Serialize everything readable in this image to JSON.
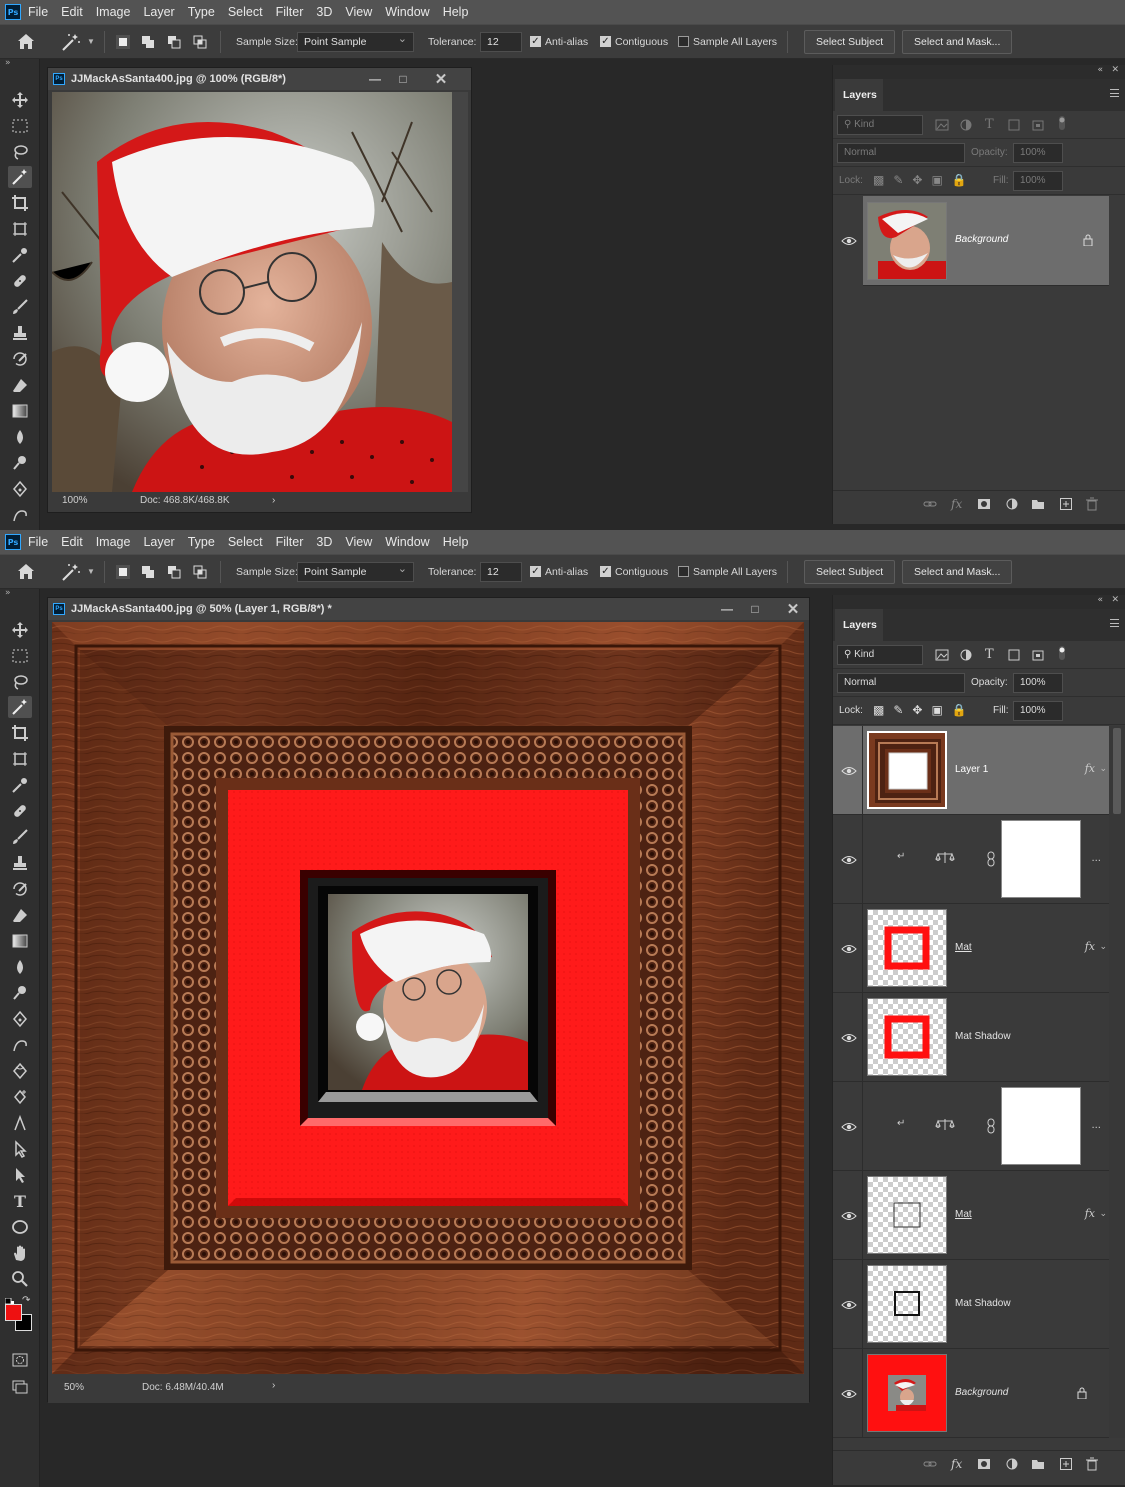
{
  "menu": [
    "File",
    "Edit",
    "Image",
    "Layer",
    "Type",
    "Select",
    "Filter",
    "3D",
    "View",
    "Window",
    "Help"
  ],
  "options": {
    "sample_size_label": "Sample Size:",
    "sample_size_value": "Point Sample",
    "tolerance_label": "Tolerance:",
    "tolerance_value": "12",
    "anti_alias": "Anti-alias",
    "contiguous": "Contiguous",
    "sample_all_layers": "Sample All Layers",
    "select_subject": "Select Subject",
    "select_and_mask": "Select and Mask..."
  },
  "panel_common": {
    "tab": "Layers",
    "kind": "Kind",
    "blend": "Normal",
    "opacity_label": "Opacity:",
    "opacity_value": "100%",
    "lock_label": "Lock:",
    "fill_label": "Fill:",
    "fill_value": "100%"
  },
  "top": {
    "doc_title": "JJMackAsSanta400.jpg @ 100% (RGB/8*)",
    "zoom": "100%",
    "doc_size": "Doc: 468.8K/468.8K",
    "layers": [
      {
        "name": "Background",
        "visible": true,
        "locked": true,
        "selected": true
      }
    ]
  },
  "bottom": {
    "doc_title": "JJMackAsSanta400.jpg @ 50% (Layer 1, RGB/8*) *",
    "zoom": "50%",
    "doc_size": "Doc: 6.48M/40.4M",
    "layers": [
      {
        "name": "Layer 1",
        "visible": true,
        "selected": true,
        "fx": true
      },
      {
        "name": "",
        "visible": true,
        "adjustment": "balance-icon"
      },
      {
        "name": "Mat",
        "visible": true,
        "fx": true
      },
      {
        "name": "Mat Shadow",
        "visible": true
      },
      {
        "name": "",
        "visible": true,
        "adjustment": "balance-icon"
      },
      {
        "name": "Mat",
        "visible": true,
        "fx": true
      },
      {
        "name": "Mat Shadow",
        "visible": true
      },
      {
        "name": "Background",
        "visible": true,
        "locked": true
      }
    ]
  },
  "colors": {
    "foreground": "#ee1111",
    "background": "#000000",
    "mat_red": "#ff1a1a",
    "wood": "#7a3a1f",
    "accent": "#31a8ff"
  },
  "fx_symbol": "fx",
  "ellipsis": "..."
}
